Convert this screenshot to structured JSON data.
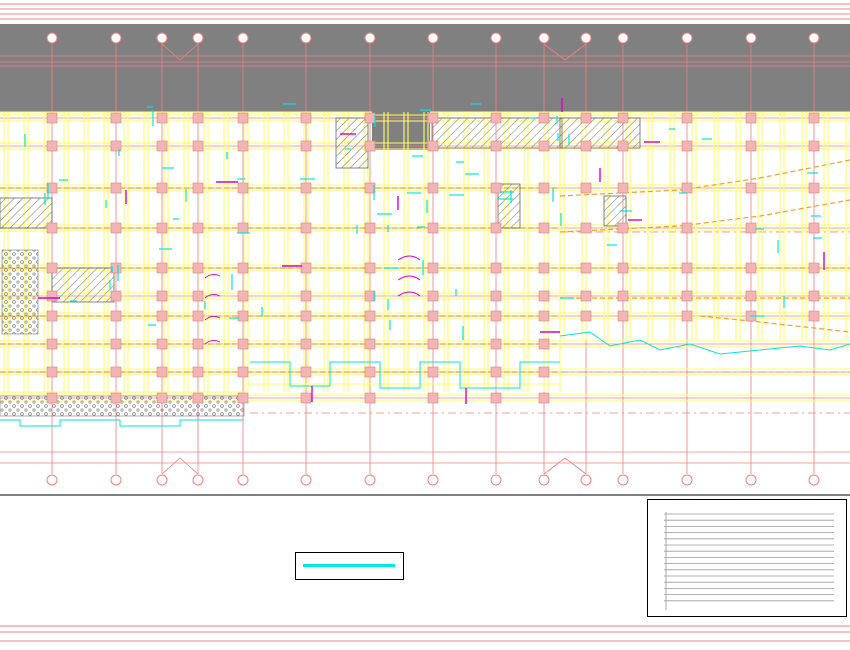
{
  "drawing": {
    "grid_axes_x": [
      52,
      116,
      162,
      198,
      243,
      306,
      370,
      433,
      496,
      544,
      586,
      623,
      687,
      751,
      814
    ],
    "grid_axes_y": [
      118,
      146,
      188,
      228,
      268,
      296,
      316,
      344,
      372,
      398
    ],
    "grid_bubble_labels_top": [],
    "grid_bubble_labels_bottom": []
  },
  "legend": {
    "items": [
      {
        "name": "cyan-line-sample",
        "color": "#00e5e5"
      }
    ]
  },
  "title_block": {
    "row_count": 15
  },
  "colors": {
    "grid": "#f08080",
    "beam": "#ffff66",
    "beam_outline": "#e6c200",
    "dim_cyan": "#00e5e5",
    "mark_magenta": "#d400d4",
    "hatch": "#9a9a9a",
    "band": "#808080",
    "column_fill": "#f2b4b4",
    "orange_dash": "#f0a030"
  }
}
